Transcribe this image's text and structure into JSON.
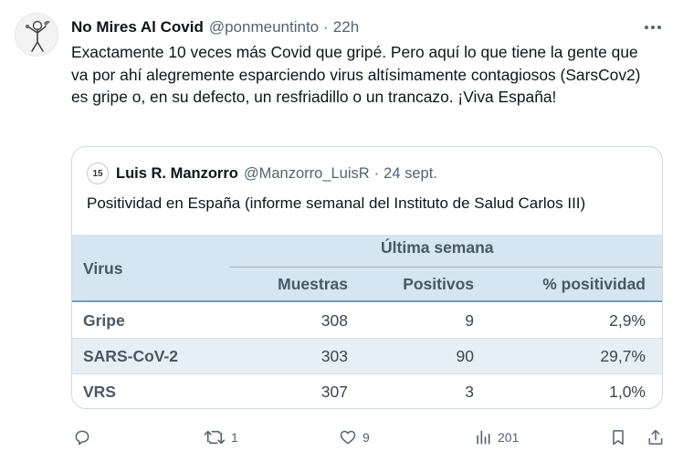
{
  "tweet": {
    "author_name": "No Mires Al Covid",
    "author_handle": "@ponmeuntinto",
    "separator": "·",
    "timestamp": "22h",
    "text": "Exactamente 10 veces más Covid que gripé. Pero aquí lo que tiene la gente que va por ahí alegremente esparciendo virus altísimamente contagiosos (SarsCov2) es gripe o, en su defecto, un resfriadillo o un trancazo. ¡Viva España!",
    "more_icon": "more-horizontal-icon"
  },
  "quote": {
    "avatar_text": "15",
    "author_name": "Luis R. Manzorro",
    "author_handle": "@Manzorro_LuisR",
    "separator": "·",
    "date": "24 sept.",
    "text": "Positividad en España (informe semanal del Instituto de Salud Carlos III)",
    "table": {
      "col_virus": "Virus",
      "group_header": "Última semana",
      "col_muestras": "Muestras",
      "col_positivos": "Positivos",
      "col_positividad": "% positividad",
      "rows": [
        {
          "virus": "Gripe",
          "muestras": "308",
          "positivos": "9",
          "positividad": "2,9%"
        },
        {
          "virus": "SARS-CoV-2",
          "muestras": "303",
          "positivos": "90",
          "positividad": "29,7%"
        },
        {
          "virus": "VRS",
          "muestras": "307",
          "positivos": "3",
          "positividad": "1,0%"
        }
      ],
      "header_bg": "#d6e5ef",
      "stripe_bg": "#e6eff5"
    }
  },
  "actions": {
    "reply_icon": "reply-icon",
    "retweet_icon": "retweet-icon",
    "retweet_count": "1",
    "like_icon": "heart-icon",
    "like_count": "9",
    "views_icon": "views-bar-chart-icon",
    "views_count": "201",
    "bookmark_icon": "bookmark-icon",
    "share_icon": "share-icon"
  }
}
